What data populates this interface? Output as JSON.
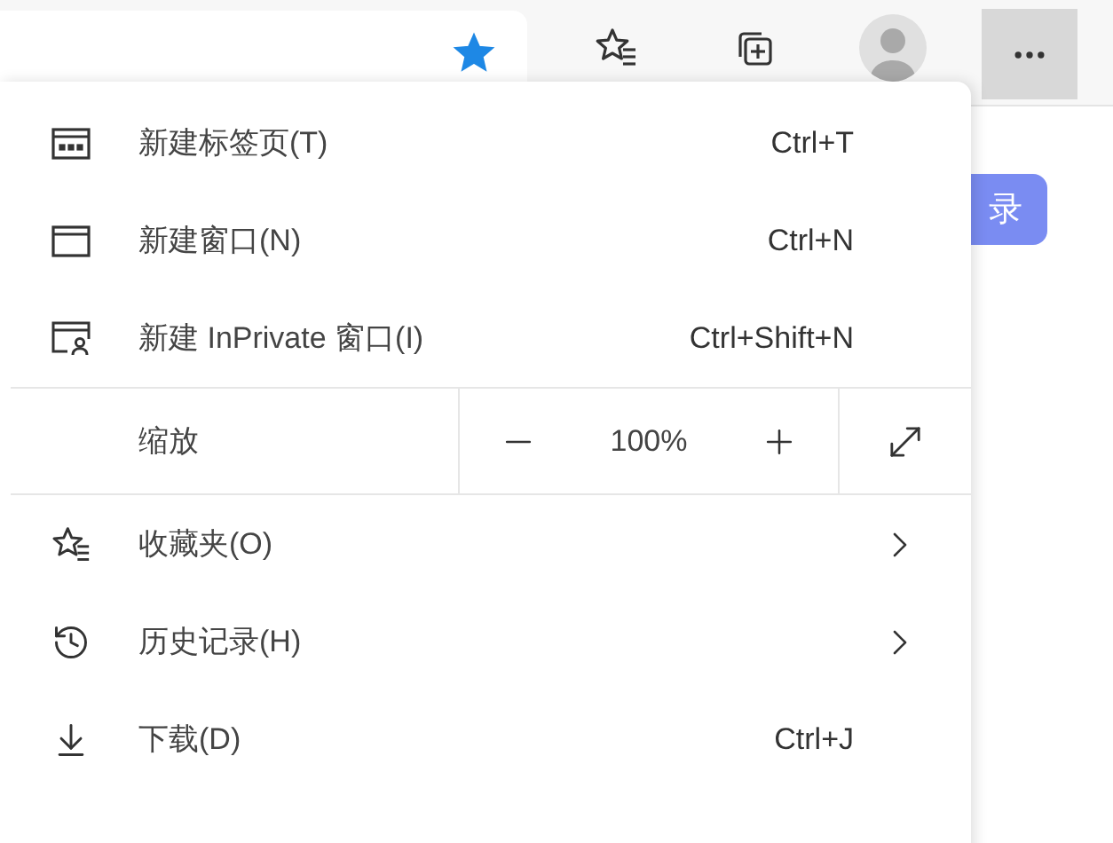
{
  "toolbar": {
    "favorite_on_page": true
  },
  "page": {
    "button_fragment": "录"
  },
  "menu": {
    "items": [
      {
        "kind": "command",
        "label": "新建标签页(T)",
        "shortcut": "Ctrl+T"
      },
      {
        "kind": "command",
        "label": "新建窗口(N)",
        "shortcut": "Ctrl+N"
      },
      {
        "kind": "command",
        "label": "新建 InPrivate 窗口(I)",
        "shortcut": "Ctrl+Shift+N"
      },
      {
        "kind": "zoom",
        "label": "缩放",
        "value": "100%"
      },
      {
        "kind": "submenu",
        "label": "收藏夹(O)"
      },
      {
        "kind": "submenu",
        "label": "历史记录(H)"
      },
      {
        "kind": "command",
        "label": "下载(D)",
        "shortcut": "Ctrl+J"
      }
    ]
  }
}
